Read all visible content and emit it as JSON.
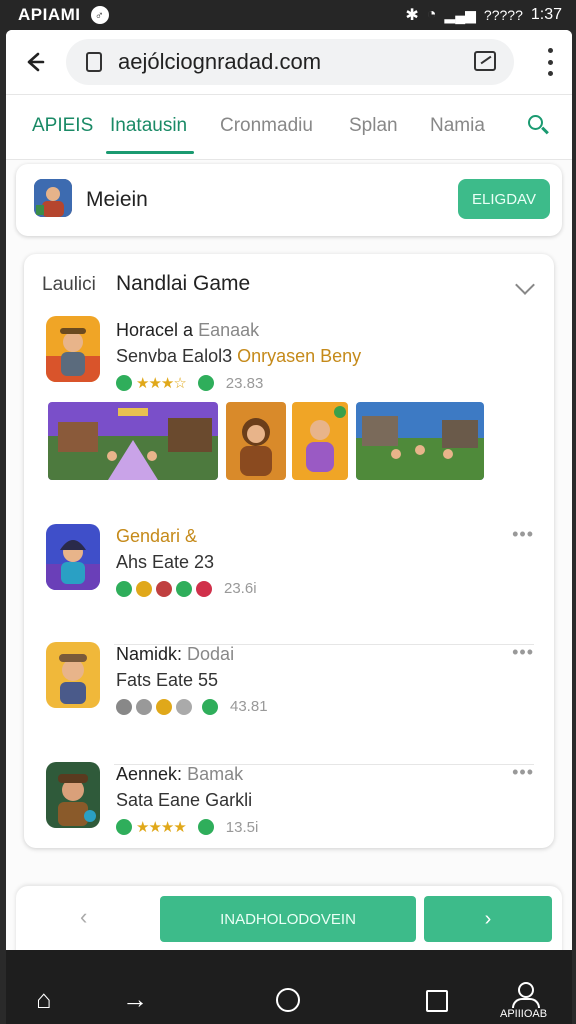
{
  "status_bar": {
    "carrier": "APIAMI",
    "app_badge": "♂",
    "battery": "?????",
    "time": "1:37"
  },
  "browser": {
    "url": "aejólciognradad.com"
  },
  "tabs": [
    {
      "label": "APIEIS"
    },
    {
      "label": "Inatausin"
    },
    {
      "label": "Cronmadiu"
    },
    {
      "label": "Splan"
    },
    {
      "label": "Namia"
    }
  ],
  "account": {
    "name": "Meiein",
    "button": "ELIGDAV"
  },
  "list": {
    "head": "Laulici",
    "title": "Nandlai Game",
    "games": [
      {
        "name": "Horacel a",
        "sub": "Eanaak",
        "line2_a": "Senvba Ealol3",
        "line2_hl": "Onryasen Beny",
        "rating": "23.83",
        "stars": "★★★☆"
      },
      {
        "name": "Gendari &",
        "sub": "",
        "line2_a": "Ahs Eate 23",
        "line2_hl": "",
        "rating": "23.6i"
      },
      {
        "name": "Namidk:",
        "sub": "Dodai",
        "line2_a": "Fats Eate 55",
        "line2_hl": "",
        "rating": "43.81"
      },
      {
        "name": "Aennek:",
        "sub": "Bamak",
        "line2_a": "Sata Eane Garkli",
        "line2_hl": "",
        "rating": "13.5i",
        "stars": "★★★★"
      }
    ],
    "more": "•••"
  },
  "bottom": {
    "prev": "‹",
    "main": "INADHOLODOVEIN",
    "next": "›"
  },
  "nav": {
    "home": "⌂",
    "forward": "→",
    "profile_label": "APIIIOAB"
  },
  "colors": {
    "accent": "#1a9a70",
    "button": "#3dbb8a"
  }
}
